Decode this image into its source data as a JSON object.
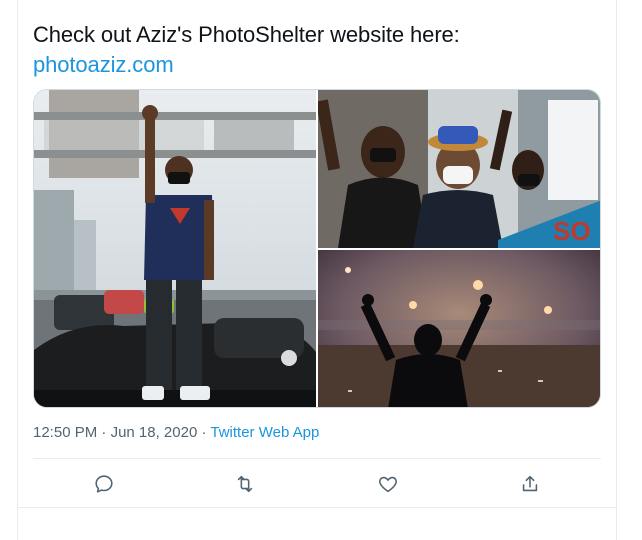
{
  "tweet": {
    "text": "Check out Aziz's PhotoShelter website here:",
    "link": "photoaziz.com"
  },
  "media": [
    {
      "icon": "photo-protester-fist-car"
    },
    {
      "icon": "photo-crowd-masks"
    },
    {
      "icon": "photo-night-tear-gas"
    }
  ],
  "meta": {
    "time": "12:50 PM",
    "sep1": " · ",
    "date": "Jun 18, 2020",
    "sep2": " · ",
    "app": "Twitter Web App"
  },
  "actions": [
    {
      "icon": "reply-icon"
    },
    {
      "icon": "retweet-icon"
    },
    {
      "icon": "like-icon"
    },
    {
      "icon": "share-icon"
    }
  ],
  "colors": {
    "link": "#1b95e0",
    "meta": "#536471",
    "icon": "#536471",
    "border": "#e6ecf0"
  }
}
